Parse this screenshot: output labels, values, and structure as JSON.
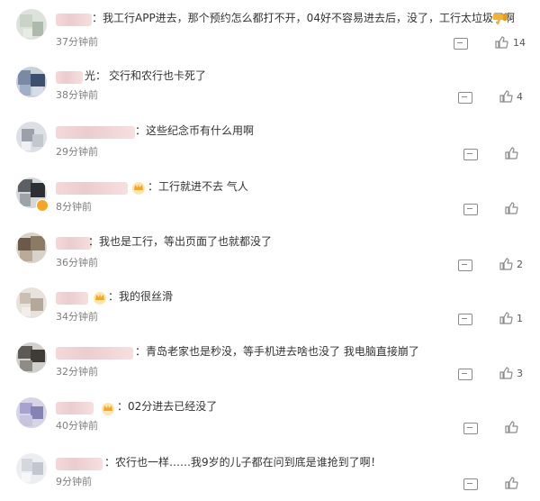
{
  "comments": [
    {
      "text": "：我工行APP进去，那个预约怎么都打不开，04好不容易进去后，没了，工行太垃圾了啊",
      "time": "37分钟前",
      "likes": "14",
      "has_crown": false,
      "thumbs_down": true
    },
    {
      "text": "交行和农行也卡死了",
      "name_suffix": "光：",
      "time": "38分钟前",
      "likes": "4",
      "has_crown": false
    },
    {
      "text": "：这些纪念币有什么用啊",
      "time": "29分钟前",
      "likes": "",
      "has_crown": false
    },
    {
      "text": "：工行就进不去 气人",
      "time": "8分钟前",
      "likes": "",
      "has_crown": true,
      "verified": true
    },
    {
      "text": "：我也是工行，等出页面了也就都没了",
      "time": "36分钟前",
      "likes": "2",
      "has_crown": false
    },
    {
      "text": "：我的很丝滑",
      "time": "34分钟前",
      "likes": "1",
      "has_crown": true
    },
    {
      "text": "：青岛老家也是秒没，等手机进去啥也没了 我电脑直接崩了",
      "time": "32分钟前",
      "likes": "3",
      "has_crown": false
    },
    {
      "text": "：02分进去已经没了",
      "time": "40分钟前",
      "likes": "",
      "has_crown": true
    },
    {
      "text": "：农行也一样……我9岁的儿子都在问到底是谁抢到了啊！",
      "time": "9分钟前",
      "likes": "",
      "has_crown": false
    }
  ],
  "colors": {
    "crown": "#f5a623",
    "icon": "#8a8a8a",
    "time": "#7f7f7f"
  },
  "icons": {
    "reply": "comment-icon",
    "like": "thumbs-up-icon",
    "dislike": "thumbs-down-icon",
    "crown": "crown-icon"
  }
}
